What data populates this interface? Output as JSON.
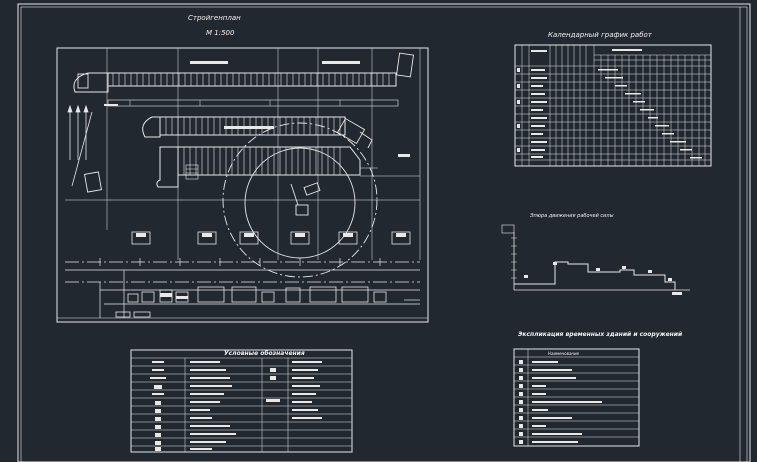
{
  "drawing": {
    "title": "Стройгенплан",
    "subtitle": "М 1:500",
    "calendar_title": "Календарный график работ",
    "labor_chart_title": "Эпюра движения рабочей силы",
    "legend_title": "Условные обозначения",
    "explication_title": "Экспликация временных зданий и сооружений",
    "explication_header": "Наименование",
    "colors": {
      "background": "#212830",
      "line": "#e8e8e8"
    },
    "icons": [
      "tower-crane-icon",
      "truck-icon",
      "excavator-icon"
    ]
  }
}
